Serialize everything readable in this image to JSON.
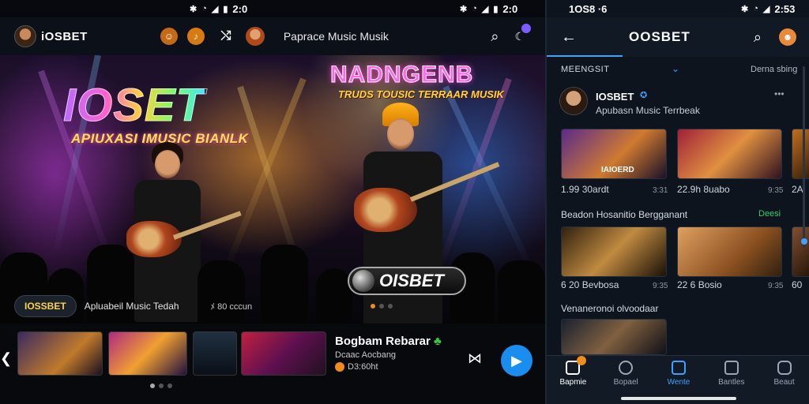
{
  "left_status": {
    "time": "2:0",
    "icons": [
      "bluetooth-icon",
      "wifi-icon",
      "signal-icon",
      "battery-icon"
    ]
  },
  "right_status_mid": {
    "time": "2:0",
    "icons": [
      "bluetooth-icon",
      "wifi-icon",
      "signal-icon",
      "battery-icon"
    ]
  },
  "left_header": {
    "logo": "iOSBET",
    "search_title": "Paprace Music Musik"
  },
  "hero": {
    "title": "IOSET",
    "subtitle": "APIUXASI IMUSIC BIANLK",
    "title2": "NADNGENB",
    "subtitle2": "TRUDS TOUSIC TERRAAR MUSIK",
    "badge_logo": "OISBET",
    "pill_label": "IOSSBET",
    "info_text": "Apluabeil Music Tedah",
    "info_stat": "ﾒ 80 cccun"
  },
  "now_playing": {
    "title": "Bogbam Rebarar",
    "artist": "Dcaac Aocbang",
    "plays": "D3:60ht"
  },
  "right_status": {
    "time": "1OS8 ·6",
    "clock": "2:53"
  },
  "right_header": {
    "title": "OOSBET"
  },
  "right_tab": {
    "label": "MEENGSIT",
    "action": "Derna sbing"
  },
  "channel": {
    "name": "IOSBET",
    "tagline": "Apubasn Music Terrbeak",
    "menu": "•••"
  },
  "section1_items": [
    {
      "label": "IAIOERD",
      "caption": "1.99 30ardt",
      "meta": "3:31"
    },
    {
      "label": "",
      "caption": "22.9h 8uabo",
      "meta": "9:35"
    },
    {
      "label": "",
      "caption": "2A",
      "meta": ""
    }
  ],
  "section2": {
    "title": "Beadon Hosanitio Bergganant",
    "action": "Deesi"
  },
  "section2_items": [
    {
      "caption": "6 20 Bevbosa",
      "meta": "9:35"
    },
    {
      "caption": "22 6 Bosio",
      "meta": "9:35"
    },
    {
      "caption": "60",
      "meta": ""
    }
  ],
  "section3": {
    "title": "Venaneronoi olvoodaar"
  },
  "nav": [
    {
      "label": "Bapmie",
      "icon": "home-icon",
      "active": false
    },
    {
      "label": "Bopael",
      "icon": "chat-icon",
      "active": false
    },
    {
      "label": "Wente",
      "icon": "library-icon",
      "active": true
    },
    {
      "label": "Bantles",
      "icon": "folder-icon",
      "active": false
    },
    {
      "label": "Beaut",
      "icon": "settings-icon",
      "active": false
    }
  ],
  "colors": {
    "accent": "#3da1ff",
    "gold": "#ffd23f",
    "pink": "#ff66e8",
    "play": "#1a8ef0"
  }
}
